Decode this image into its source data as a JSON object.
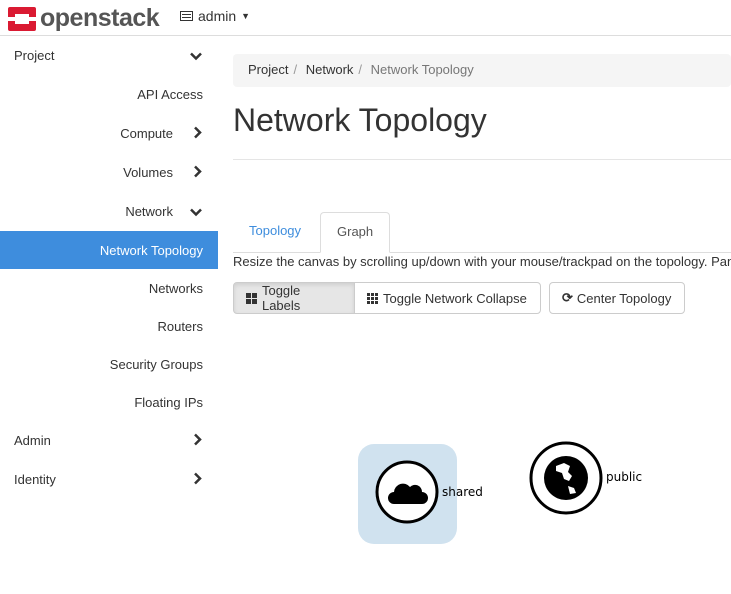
{
  "header": {
    "brand": "openstack",
    "project_selector": "admin"
  },
  "sidebar": {
    "items": [
      {
        "label": "Project",
        "level": "top",
        "chevron": "down"
      },
      {
        "label": "API Access",
        "level": "sub"
      },
      {
        "label": "Compute",
        "level": "sub",
        "chevron": "right"
      },
      {
        "label": "Volumes",
        "level": "sub",
        "chevron": "right"
      },
      {
        "label": "Network",
        "level": "sub",
        "chevron": "down"
      },
      {
        "label": "Network Topology",
        "level": "sub2",
        "active": true
      },
      {
        "label": "Networks",
        "level": "sub2"
      },
      {
        "label": "Routers",
        "level": "sub2"
      },
      {
        "label": "Security Groups",
        "level": "sub2"
      },
      {
        "label": "Floating IPs",
        "level": "sub2"
      },
      {
        "label": "Admin",
        "level": "top",
        "chevron": "right"
      },
      {
        "label": "Identity",
        "level": "top",
        "chevron": "right"
      }
    ]
  },
  "breadcrumb": [
    "Project",
    "Network",
    "Network Topology"
  ],
  "page_title": "Network Topology",
  "tabs": [
    {
      "label": "Topology"
    },
    {
      "label": "Graph",
      "active": true
    }
  ],
  "description": "Resize the canvas by scrolling up/down with your mouse/trackpad on the topology. Pan",
  "buttons": {
    "toggle_labels": "Toggle Labels",
    "toggle_collapse": "Toggle Network Collapse",
    "center": "Center Topology"
  },
  "topology": {
    "nodes": [
      {
        "label": "shared",
        "icon": "cloud-icon"
      },
      {
        "label": "public",
        "icon": "globe-icon"
      }
    ]
  },
  "colors": {
    "accent": "#3e8ddd",
    "brand": "#da1a32",
    "shared_bg": "#d0e2ef"
  }
}
